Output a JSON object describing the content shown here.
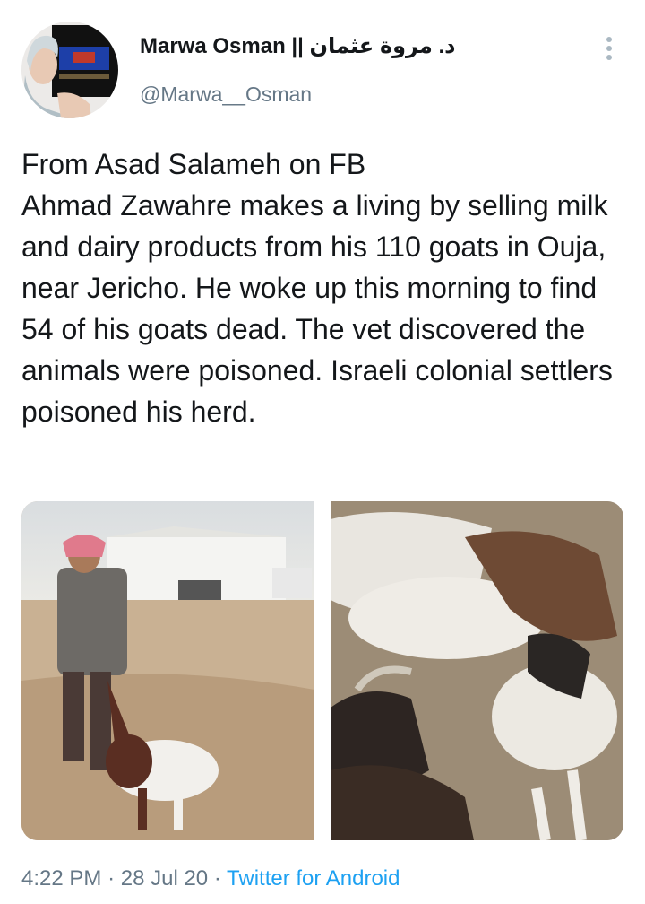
{
  "author": {
    "display_name": "Marwa Osman || د. مروة عثمان",
    "handle": "@Marwa__Osman"
  },
  "tweet": {
    "lines": [
      "From Asad Salameh on FB",
      "Ahmad Zawahre makes a living by selling milk and dairy products from his 110 goats in Ouja, near Jericho.  He woke up this morning to find 54 of his goats dead. The vet discovered the animals were poisoned. Israeli colonial settlers poisoned his herd."
    ]
  },
  "meta": {
    "time": "4:22 PM",
    "separator": "·",
    "date": "28 Jul 20",
    "source": "Twitter for Android"
  },
  "icons": {
    "more": "more-vertical-icon"
  },
  "colors": {
    "text": "#14171a",
    "secondary": "#657786",
    "link": "#1da1f2"
  }
}
